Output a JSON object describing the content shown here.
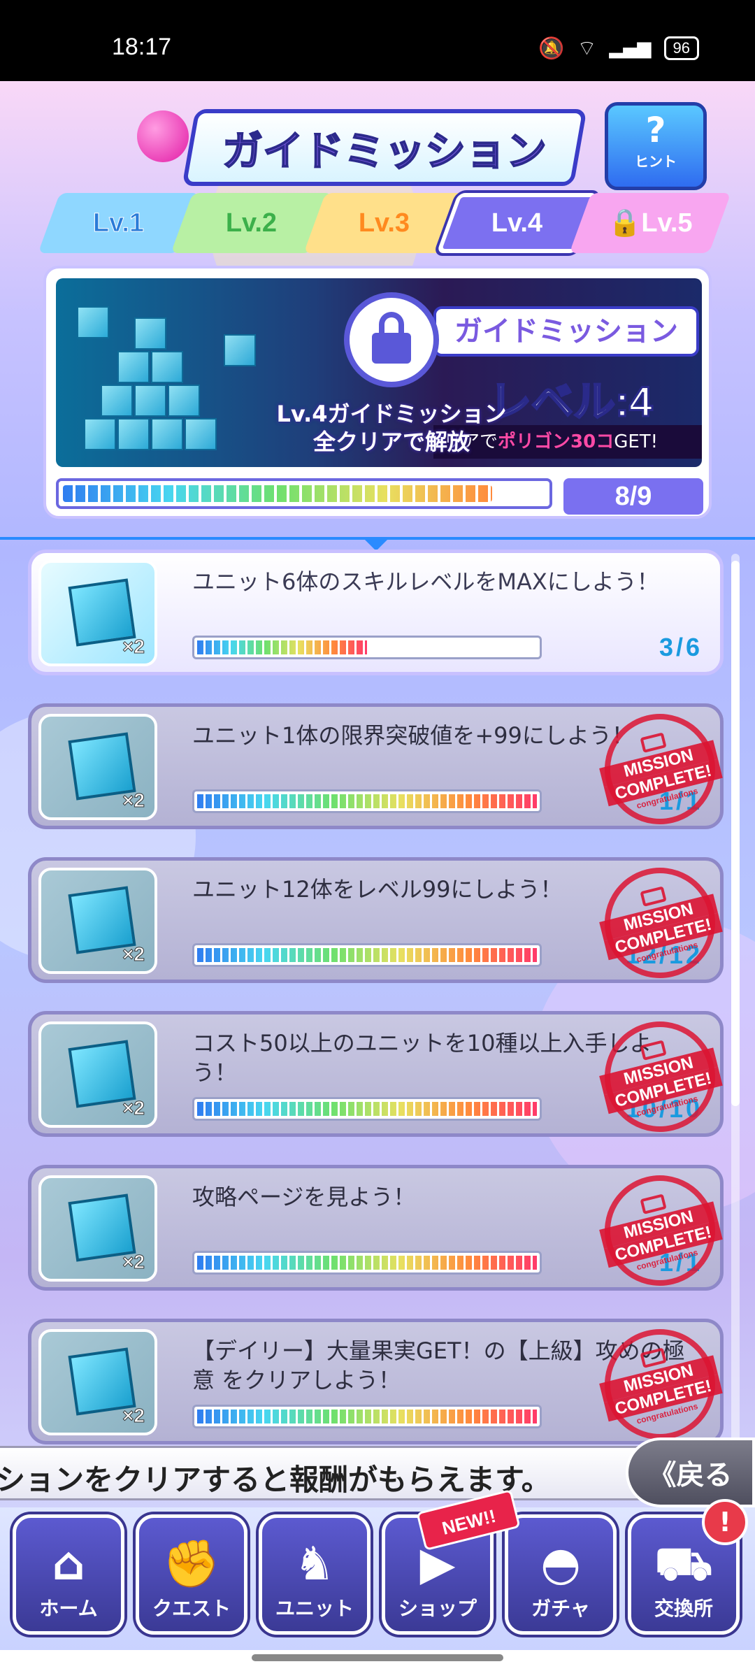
{
  "status_bar": {
    "time": "18:17",
    "battery": "96"
  },
  "header": {
    "title": "ガイドミッション",
    "hint_label": "ヒント",
    "hint_symbol": "?"
  },
  "tabs": [
    {
      "label": "Lv.1"
    },
    {
      "label": "Lv.2"
    },
    {
      "label": "Lv.3"
    },
    {
      "label": "Lv.4",
      "selected": true
    },
    {
      "label": "Lv.5",
      "locked": true
    }
  ],
  "reward": {
    "banner_title": "ガイドミッション",
    "level_text": "レベル:4",
    "sub_prefix": "リアで",
    "sub_highlight": "ポリゴン30コ",
    "sub_suffix": "GET!",
    "lock_caption_1": "Lv.4ガイドミッション",
    "lock_caption_2": "全クリアで解放",
    "progress_count": "8/9",
    "progress_fraction": 0.89
  },
  "missions": [
    {
      "text": "ユニット6体のスキルレベルをMAXにしよう！",
      "multiplier": "×2",
      "count": "3/6",
      "progress": 0.5,
      "complete": false
    },
    {
      "text": "ユニット1体の限界突破値を+99にしよう！",
      "multiplier": "×2",
      "count": "1/1",
      "progress": 1.0,
      "complete": true
    },
    {
      "text": "ユニット12体をレベル99にしよう！",
      "multiplier": "×2",
      "count": "12/12",
      "progress": 1.0,
      "complete": true
    },
    {
      "text": "コスト50以上のユニットを10種以上入手しよう！",
      "multiplier": "×2",
      "count": "10/10",
      "progress": 1.0,
      "complete": true
    },
    {
      "text": "攻略ページを見よう！",
      "multiplier": "×2",
      "count": "1/1",
      "progress": 1.0,
      "complete": true
    },
    {
      "text": "【デイリー】大量果実GET！の【上級】攻めの極意 をクリアしよう！",
      "multiplier": "×2",
      "count": "",
      "progress": 1.0,
      "complete": true
    }
  ],
  "stamp": {
    "line1": "MISSION",
    "line2": "COMPLETE!",
    "small": "congratulations"
  },
  "ticker": {
    "text": "ションをクリアすると報酬がもらえます。"
  },
  "back_button": {
    "label": "《戻る"
  },
  "bottom_nav": [
    {
      "label": "ホーム",
      "icon": "home-icon"
    },
    {
      "label": "クエスト",
      "icon": "handshake-icon"
    },
    {
      "label": "ユニット",
      "icon": "rabbit-icon"
    },
    {
      "label": "ショップ",
      "icon": "shop-icon"
    },
    {
      "label": "ガチャ",
      "icon": "egg-icon"
    },
    {
      "label": "交換所",
      "icon": "cart-icon"
    }
  ],
  "new_badge": "NEW!!",
  "alert_badge": "!",
  "colors": {
    "accent": "#5a58d8",
    "complete_stamp": "#dc1432",
    "count_blue": "#1a9adf"
  }
}
